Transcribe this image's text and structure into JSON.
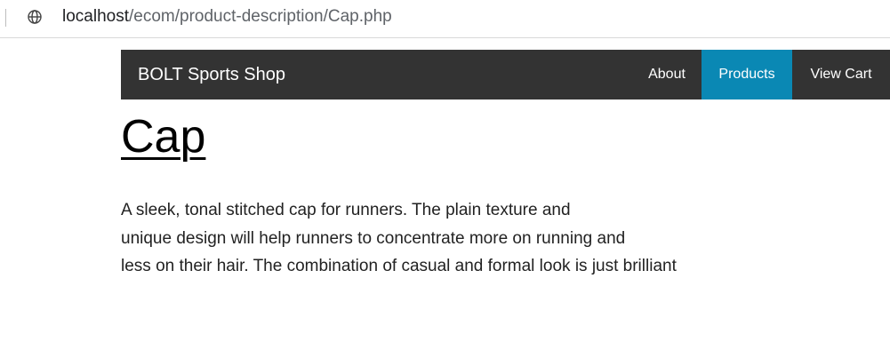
{
  "browser": {
    "url_host": "localhost",
    "url_path": "/ecom/product-description/Cap.php",
    "icon": "globe-icon"
  },
  "navbar": {
    "brand": "BOLT Sports Shop",
    "items": [
      {
        "label": "About",
        "active": false
      },
      {
        "label": "Products",
        "active": true
      },
      {
        "label": "View Cart",
        "active": false
      }
    ],
    "background_color": "#333333",
    "active_color": "#0a88b4"
  },
  "product": {
    "title": "Cap",
    "description_lines": [
      "A sleek, tonal stitched cap for runners. The plain texture and",
      "unique design will help runners to concentrate more on running and",
      "less on their hair. The combination of casual and formal look is just brilliant"
    ]
  }
}
